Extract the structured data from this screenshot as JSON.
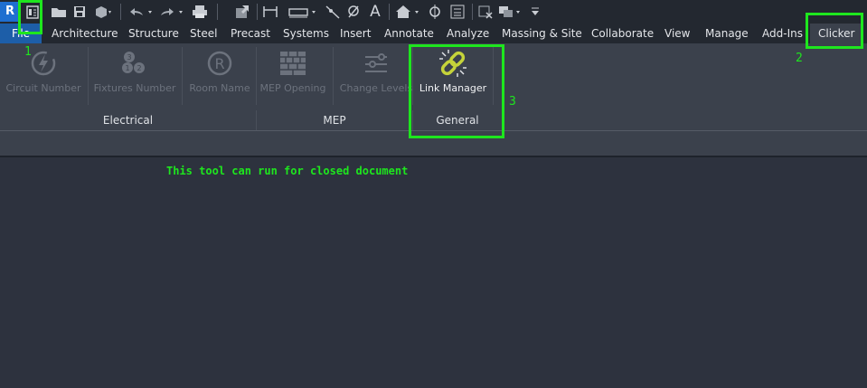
{
  "app": {
    "logo_letter": "R"
  },
  "tabs": [
    {
      "label": "File"
    },
    {
      "label": "Architecture"
    },
    {
      "label": "Structure"
    },
    {
      "label": "Steel"
    },
    {
      "label": "Precast"
    },
    {
      "label": "Systems"
    },
    {
      "label": "Insert"
    },
    {
      "label": "Annotate"
    },
    {
      "label": "Analyze"
    },
    {
      "label": "Massing & Site"
    },
    {
      "label": "Collaborate"
    },
    {
      "label": "View"
    },
    {
      "label": "Manage"
    },
    {
      "label": "Add-Ins"
    },
    {
      "label": "Clicker"
    }
  ],
  "active_tab": "Clicker",
  "ribbon": {
    "buttons": [
      {
        "label": "Circuit Number",
        "icon": "lightning-circle-icon",
        "enabled": false
      },
      {
        "label": "Fixtures Number",
        "icon": "numbered-dots-icon",
        "enabled": false
      },
      {
        "label": "Room Name",
        "icon": "r-circle-icon",
        "enabled": false
      },
      {
        "label": "MEP Opening",
        "icon": "brick-wall-icon",
        "enabled": false
      },
      {
        "label": "Change Levels",
        "icon": "sliders-icon",
        "enabled": false
      },
      {
        "label": "Link Manager",
        "icon": "chain-link-icon",
        "enabled": true
      }
    ],
    "panels": [
      {
        "title": "Electrical"
      },
      {
        "title": "MEP"
      },
      {
        "title": "General"
      }
    ]
  },
  "annotations": {
    "markers": [
      "1",
      "2",
      "3"
    ],
    "note": "This tool can run for closed document",
    "color": "#1ee61e"
  },
  "colors": {
    "background": "#2d323e",
    "ribbon": "#3b414c",
    "file_tab": "#1d5ea8"
  }
}
